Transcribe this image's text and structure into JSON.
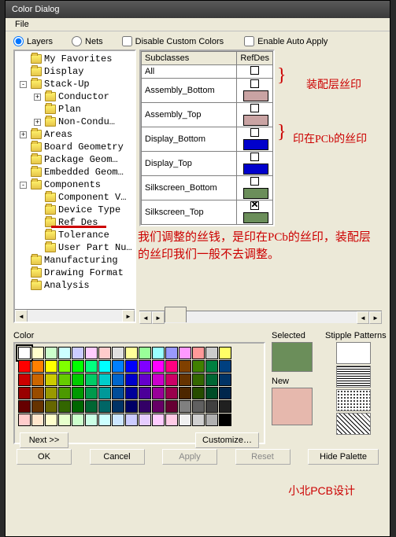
{
  "title": "Color Dialog",
  "menu": {
    "file": "File"
  },
  "top": {
    "layers": "Layers",
    "nets": "Nets",
    "disable": "Disable Custom Colors",
    "auto": "Enable Auto Apply"
  },
  "tree": [
    {
      "lvl": 1,
      "box": "",
      "label": "My Favorites"
    },
    {
      "lvl": 1,
      "box": "",
      "label": "Display"
    },
    {
      "lvl": 1,
      "box": "-",
      "label": "Stack-Up"
    },
    {
      "lvl": 2,
      "box": "+",
      "label": "Conductor"
    },
    {
      "lvl": 2,
      "box": "",
      "label": "Plan"
    },
    {
      "lvl": 2,
      "box": "+",
      "label": "Non-Condu…"
    },
    {
      "lvl": 1,
      "box": "+",
      "label": "Areas"
    },
    {
      "lvl": 1,
      "box": "",
      "label": "Board Geometry"
    },
    {
      "lvl": 1,
      "box": "",
      "label": "Package Geom…"
    },
    {
      "lvl": 1,
      "box": "",
      "label": "Embedded Geom…"
    },
    {
      "lvl": 1,
      "box": "-",
      "label": "Components"
    },
    {
      "lvl": 2,
      "box": "",
      "label": "Component V…"
    },
    {
      "lvl": 2,
      "box": "",
      "label": "Device Type"
    },
    {
      "lvl": 2,
      "box": "",
      "label": "Ref Des"
    },
    {
      "lvl": 2,
      "box": "",
      "label": "Tolerance"
    },
    {
      "lvl": 2,
      "box": "",
      "label": "User Part Nu…"
    },
    {
      "lvl": 1,
      "box": "",
      "label": "Manufacturing"
    },
    {
      "lvl": 1,
      "box": "",
      "label": "Drawing Format"
    },
    {
      "lvl": 1,
      "box": "",
      "label": "Analysis"
    }
  ],
  "grid": {
    "h1": "Subclasses",
    "h2": "RefDes",
    "rows": [
      {
        "name": "All",
        "chk": false,
        "color": ""
      },
      {
        "name": "Assembly_Bottom",
        "chk": false,
        "color": "#c9a3a3"
      },
      {
        "name": "Assembly_Top",
        "chk": false,
        "color": "#c9a3a3"
      },
      {
        "name": "Display_Bottom",
        "chk": false,
        "color": "#0000cc"
      },
      {
        "name": "Display_Top",
        "chk": false,
        "color": "#0000cc"
      },
      {
        "name": "Silkscreen_Bottom",
        "chk": false,
        "color": "#6b8e5a"
      },
      {
        "name": "Silkscreen_Top",
        "chk": true,
        "color": "#6b8e5a"
      }
    ]
  },
  "ann": {
    "a1": "装配层丝印",
    "a2": "印在PCb的丝印",
    "body": "我们调整的丝钱，是印在PCb的丝印，装配层的丝印我们一般不去调整。"
  },
  "colors": {
    "label": "Color",
    "selected_label": "Selected",
    "new_label": "New",
    "stipple_label": "Stipple Patterns",
    "next": "Next >>",
    "customize": "Customize…",
    "selected_color": "#6b8e5a",
    "new_color": "#e6b8ad",
    "palette": [
      "#ffffff",
      "#ffffcc",
      "#ccffcc",
      "#ccffff",
      "#ccccff",
      "#ffccff",
      "#ffcccc",
      "#e0e0e0",
      "#ffff99",
      "#99ff99",
      "#99ffff",
      "#9999ff",
      "#ff99ff",
      "#ff9999",
      "#cccccc",
      "#ffff66",
      "#ff0000",
      "#ff8000",
      "#ffff00",
      "#80ff00",
      "#00ff00",
      "#00ff80",
      "#00ffff",
      "#0080ff",
      "#0000ff",
      "#8000ff",
      "#ff00ff",
      "#ff0080",
      "#804000",
      "#408000",
      "#008040",
      "#004080",
      "#cc0000",
      "#cc6600",
      "#cccc00",
      "#66cc00",
      "#00cc00",
      "#00cc66",
      "#00cccc",
      "#0066cc",
      "#0000cc",
      "#6600cc",
      "#cc00cc",
      "#cc0066",
      "#663300",
      "#336600",
      "#006633",
      "#003366",
      "#990000",
      "#994c00",
      "#999900",
      "#4c9900",
      "#009900",
      "#00994c",
      "#009999",
      "#004c99",
      "#000099",
      "#4c0099",
      "#990099",
      "#99004c",
      "#4c2600",
      "#264c00",
      "#004c26",
      "#00264c",
      "#660000",
      "#663300",
      "#666600",
      "#336600",
      "#006600",
      "#006633",
      "#006666",
      "#003366",
      "#000066",
      "#330066",
      "#660066",
      "#660033",
      "#808080",
      "#606060",
      "#404040",
      "#202020",
      "#ffcccc",
      "#ffe6cc",
      "#ffffcc",
      "#e6ffcc",
      "#ccffcc",
      "#ccffe6",
      "#ccffff",
      "#cce6ff",
      "#ccccff",
      "#e6ccff",
      "#ffccff",
      "#ffcce6",
      "#f0f0f0",
      "#d0d0d0",
      "#b0b0b0",
      "#000000"
    ]
  },
  "footer": {
    "ok": "OK",
    "cancel": "Cancel",
    "apply": "Apply",
    "reset": "Reset",
    "hide": "Hide Palette"
  },
  "watermark": "小北PCB设计"
}
